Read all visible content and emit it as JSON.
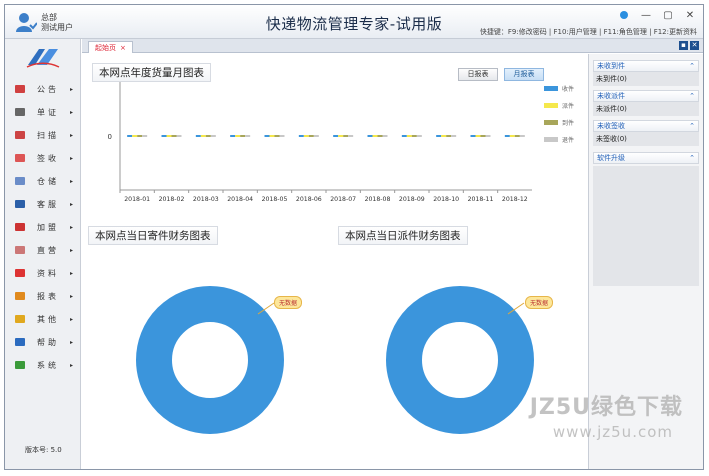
{
  "titlebar": {
    "user_org": "总部",
    "user_name": "测试用户",
    "app_title": "快递物流管理专家-试用版",
    "shortcuts": "快捷键：F9:修改密码 | F10:用户管理 | F11:角色管理 | F12:更新资料",
    "icons": [
      "user-avatar-icon",
      "skin-icon",
      "minimize-icon",
      "maximize-icon",
      "close-icon"
    ]
  },
  "sidebar": {
    "logo": "JZ-logo",
    "items": [
      {
        "label": "公告",
        "icon": "megaphone-icon"
      },
      {
        "label": "单证",
        "icon": "document-icon"
      },
      {
        "label": "扫描",
        "icon": "scan-icon"
      },
      {
        "label": "签收",
        "icon": "sign-icon"
      },
      {
        "label": "仓储",
        "icon": "warehouse-icon"
      },
      {
        "label": "客服",
        "icon": "service-icon"
      },
      {
        "label": "加盟",
        "icon": "franchise-icon"
      },
      {
        "label": "直营",
        "icon": "direct-icon"
      },
      {
        "label": "资料",
        "icon": "data-icon"
      },
      {
        "label": "报表",
        "icon": "report-icon"
      },
      {
        "label": "其他",
        "icon": "other-icon"
      },
      {
        "label": "帮助",
        "icon": "help-icon"
      },
      {
        "label": "系统",
        "icon": "system-icon"
      }
    ],
    "version": "版本号: 5.0"
  },
  "tabs": {
    "home_label": "起始页",
    "close_glyph": "×"
  },
  "main": {
    "monthly_chart_title": "本网点年度货量月图表",
    "btn_day": "日报表",
    "btn_month": "月报表",
    "send_chart_title": "本网点当日寄件财务图表",
    "dispatch_chart_title": "本网点当日派件财务图表",
    "no_data_label": "无数据"
  },
  "chart_data": [
    {
      "type": "line",
      "title": "本网点年度货量月图表",
      "categories": [
        "2018-01",
        "2018-02",
        "2018-03",
        "2018-04",
        "2018-05",
        "2018-06",
        "2018-07",
        "2018-08",
        "2018-09",
        "2018-10",
        "2018-11",
        "2018-12"
      ],
      "y_ticks": [
        "0"
      ],
      "series": [
        {
          "name": "收件",
          "color": "#3b95dc",
          "values": [
            0,
            0,
            0,
            0,
            0,
            0,
            0,
            0,
            0,
            0,
            0,
            0
          ]
        },
        {
          "name": "派件",
          "color": "#f5e84c",
          "values": [
            0,
            0,
            0,
            0,
            0,
            0,
            0,
            0,
            0,
            0,
            0,
            0
          ]
        },
        {
          "name": "到件",
          "color": "#a8a65a",
          "values": [
            0,
            0,
            0,
            0,
            0,
            0,
            0,
            0,
            0,
            0,
            0,
            0
          ]
        },
        {
          "name": "退件",
          "color": "#c8c8c8",
          "values": [
            0,
            0,
            0,
            0,
            0,
            0,
            0,
            0,
            0,
            0,
            0,
            0
          ]
        }
      ]
    },
    {
      "type": "pie",
      "title": "本网点当日寄件财务图表",
      "slices": [
        {
          "label": "无数据",
          "value": 1,
          "color": "#3b95dc"
        }
      ]
    },
    {
      "type": "pie",
      "title": "本网点当日派件财务图表",
      "slices": [
        {
          "label": "无数据",
          "value": 1,
          "color": "#3b95dc"
        }
      ]
    }
  ],
  "rightpanel": {
    "sections": [
      {
        "title": "未收到件",
        "body": "未到件(0)"
      },
      {
        "title": "未收派件",
        "body": "未派件(0)"
      },
      {
        "title": "未收签收",
        "body": "未签收(0)"
      },
      {
        "title": "软件升级",
        "body": ""
      }
    ],
    "collapse_glyph": "⌃"
  },
  "watermark": {
    "line1": "JZ5U绿色下载",
    "line2": "www.jz5u.com"
  }
}
